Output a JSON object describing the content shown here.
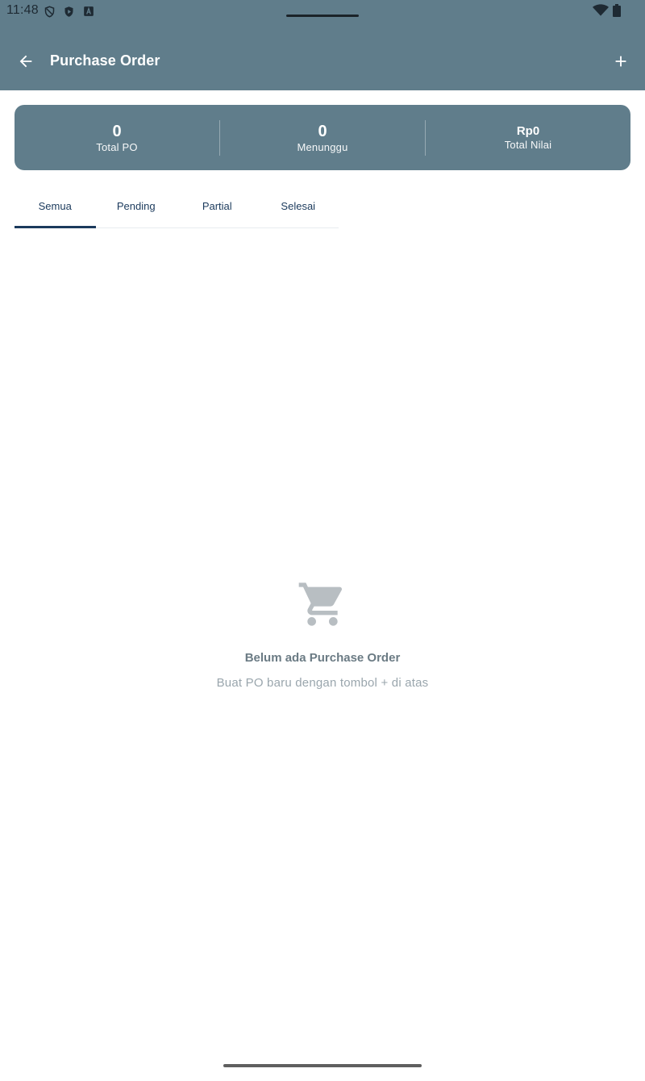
{
  "status_bar": {
    "time": "11:48",
    "icons": [
      "shield-icon",
      "play-protect-icon",
      "font-a-icon",
      "wifi-icon",
      "battery-icon"
    ]
  },
  "toolbar": {
    "title": "Purchase Order",
    "back_icon": "arrow-left-icon",
    "add_icon": "plus-icon"
  },
  "summary": {
    "stats": [
      {
        "value": "0",
        "label": "Total PO"
      },
      {
        "value": "0",
        "label": "Menunggu"
      },
      {
        "value": "Rp0",
        "label": "Total Nilai"
      }
    ]
  },
  "tabs": [
    {
      "label": "Semua",
      "active": true
    },
    {
      "label": "Pending",
      "active": false
    },
    {
      "label": "Partial",
      "active": false
    },
    {
      "label": "Selesai",
      "active": false
    }
  ],
  "empty_state": {
    "icon": "shopping-cart-icon",
    "title": "Belum ada Purchase Order",
    "subtitle": "Buat PO baru dengan tombol + di atas"
  },
  "colors": {
    "primary": "#607d8b",
    "tab_text": "#1b3a5c",
    "empty_icon": "#b8bec2"
  }
}
